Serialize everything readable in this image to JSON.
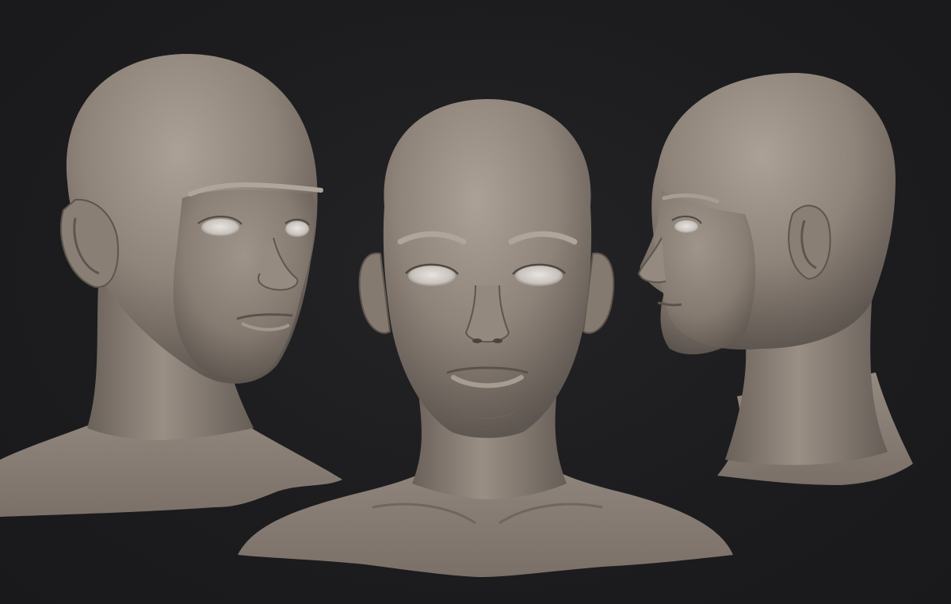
{
  "scene": {
    "background_color": "#1c1c1e",
    "clay_color": "#8e8379",
    "clay_highlight": "#a89d93",
    "clay_shadow": "#5c544d",
    "views": [
      {
        "view": "three-quarter-left"
      },
      {
        "view": "front"
      },
      {
        "view": "profile-right"
      }
    ]
  }
}
